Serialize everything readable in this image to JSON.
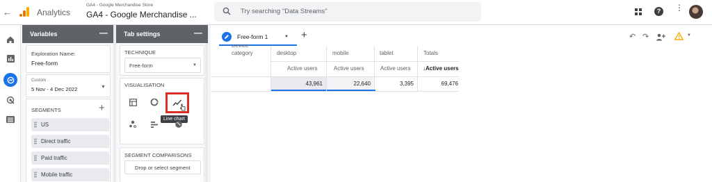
{
  "app": {
    "name": "Analytics",
    "property_small": "GA4 - Google Merchandise Store",
    "property_large": "GA4 - Google Merchandise ..."
  },
  "search": {
    "placeholder": "Try searching \"Data Streams\""
  },
  "variables": {
    "title": "Variables",
    "exploration_label": "Exploration Name:",
    "exploration_name": "Free-form",
    "date_custom": "Custom",
    "date_range": "5 Nov - 4 Dec 2022",
    "segments_label": "SEGMENTS",
    "segments": [
      "US",
      "Direct traffic",
      "Paid traffic",
      "Mobile traffic"
    ]
  },
  "tab_settings": {
    "title": "Tab settings",
    "technique_label": "TECHNIQUE",
    "technique_value": "Free-form",
    "visualisation_label": "VISUALISATION",
    "tooltip": "Line chart",
    "segment_comparisons_label": "SEGMENT COMPARISONS",
    "drop_segment": "Drop or select segment"
  },
  "canvas": {
    "tab_label": "Free-form 1",
    "table": {
      "row_dim_partial": "Device",
      "row_dim": "category",
      "columns": [
        "desktop",
        "mobile",
        "tablet",
        "Totals"
      ],
      "metric_labels": [
        "Active users",
        "Active users",
        "Active users",
        "↓Active users"
      ],
      "values": [
        "43,961",
        "22,640",
        "3,395",
        "69,476"
      ]
    }
  },
  "colors": {
    "accent": "#1a73e8",
    "orange": "#f9ab00",
    "highlight": "#d93025"
  }
}
